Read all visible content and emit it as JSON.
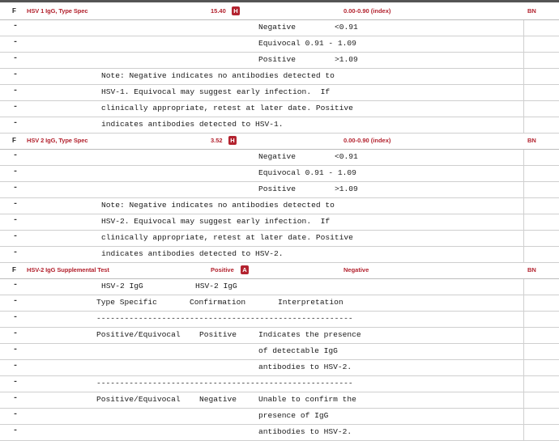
{
  "colors": {
    "flag_red": "#b3232f",
    "text": "#1a1a1a",
    "rule": "#cfcfcf"
  },
  "dash": "-",
  "tests": [
    {
      "flag": "F",
      "name": "HSV 1 IgG, Type Spec",
      "value": "15.40",
      "abnormal_flag": "H",
      "reference": "0.00-0.90 (index)",
      "lab": "BN",
      "comment_lines": [
        {
          "cols": [
            "Negative",
            "<0.91"
          ]
        },
        {
          "cols": [
            "Equivocal 0.91 - 1.09"
          ]
        },
        {
          "cols": [
            "Positive",
            ">1.09"
          ]
        },
        {
          "cols": [
            "Note: Negative indicates no antibodies detected to"
          ]
        },
        {
          "cols": [
            "HSV-1. Equivocal may suggest early infection.  If"
          ]
        },
        {
          "cols": [
            "clinically appropriate, retest at later date. Positive"
          ]
        },
        {
          "cols": [
            "indicates antibodies detected to HSV-1."
          ]
        }
      ]
    },
    {
      "flag": "F",
      "name": "HSV 2 IgG, Type Spec",
      "value": "3.52",
      "abnormal_flag": "H",
      "reference": "0.00-0.90 (index)",
      "lab": "BN",
      "comment_lines": [
        {
          "cols": [
            "Negative",
            "<0.91"
          ]
        },
        {
          "cols": [
            "Equivocal 0.91 - 1.09"
          ]
        },
        {
          "cols": [
            "Positive",
            ">1.09"
          ]
        },
        {
          "cols": [
            "Note: Negative indicates no antibodies detected to"
          ]
        },
        {
          "cols": [
            "HSV-2. Equivocal may suggest early infection.  If"
          ]
        },
        {
          "cols": [
            "clinically appropriate, retest at later date. Positive"
          ]
        },
        {
          "cols": [
            "indicates antibodies detected to HSV-2."
          ]
        }
      ]
    },
    {
      "flag": "F",
      "name": "HSV-2 IgG Supplemental Test",
      "value": "Positive",
      "abnormal_flag": "A",
      "reference": "Negative",
      "lab": "BN",
      "comment_lines": [
        {
          "cols": [
            "HSV-2 IgG",
            "HSV-2 IgG"
          ]
        },
        {
          "cols": [
            "Type Specific",
            "Confirmation",
            "Interpretation"
          ]
        },
        {
          "cols": [
            "-------------------------------------------------------"
          ]
        },
        {
          "cols": [
            "Positive/Equivocal",
            "Positive",
            "Indicates the presence"
          ]
        },
        {
          "cols": [
            "of detectable IgG"
          ]
        },
        {
          "cols": [
            "antibodies to HSV-2."
          ]
        },
        {
          "cols": [
            "-------------------------------------------------------"
          ]
        },
        {
          "cols": [
            "Positive/Equivocal",
            "Negative",
            "Unable to confirm the"
          ]
        },
        {
          "cols": [
            "presence of IgG"
          ]
        },
        {
          "cols": [
            "antibodies to HSV-2."
          ]
        }
      ]
    }
  ]
}
